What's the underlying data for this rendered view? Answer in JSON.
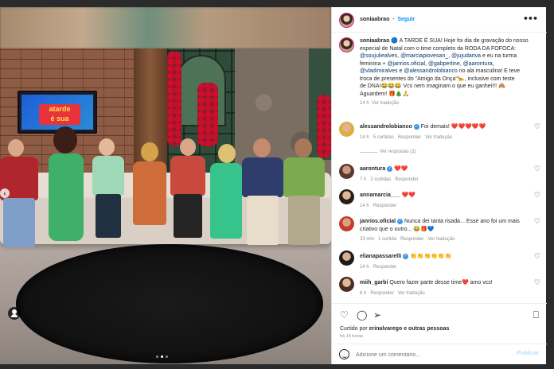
{
  "post_header": {
    "username": "soniaabrao",
    "separator": "•",
    "follow_label": "Seguir"
  },
  "caption": {
    "username": "soniaabrao",
    "lines": [
      "A TARDE É SUA! Hoje foi dia de gravação do nosso",
      "especial de Natal com o time completo da RODA DA FOFOCA:",
      "e eu na turma",
      "feminina +",
      "no ala masculina! E teve",
      "troca de presentes do \"Amigo da Onça\"🐆, inclusive com teste",
      "de DNA!😂😂😂 Vcs nem imaginam o que eu ganhei!!! 🙈",
      "Aguardem! 🎁🎄🙏"
    ],
    "intro_prefix": "🔵",
    "mentions_line3": [
      "@soujuliealves",
      "@marciapiovesan_",
      "@jujudariva"
    ],
    "mentions_line4": [
      "@janrios.oficial",
      "@gabperline",
      "@aarontura"
    ],
    "mentions_line5": [
      "@vladimiralves",
      "@alessandrolobianco"
    ],
    "time": "14 h",
    "translate": "Ver tradução"
  },
  "comments": [
    {
      "username": "alessandrolobianco",
      "verified": true,
      "text": "Foi demais! ❤️❤️❤️❤️❤️",
      "time": "14 h",
      "likes": "5 curtidas",
      "reply": "Responder",
      "translate": "Ver tradução",
      "view_replies": "Ver respostas (1)"
    },
    {
      "username": "aarontura",
      "verified": true,
      "text": "❤️❤️",
      "time": "7 h",
      "likes": "2 curtidas",
      "reply": "Responder"
    },
    {
      "username": "annamarcia___",
      "verified": false,
      "text": "❤️❤️",
      "time": "14 h",
      "reply": "Responder"
    },
    {
      "username": "janrios.oficial",
      "verified": true,
      "text": "Nunca dei tanta risada... Esse ano foi um mais",
      "text2": "criativo que o outro... 😂🎁💙",
      "time": "33 min",
      "likes": "1 curtida",
      "reply": "Responder",
      "translate": "Ver tradução"
    },
    {
      "username": "elianapassarelli",
      "verified": true,
      "text": "👏👏👏👏👏👏",
      "time": "14 h",
      "reply": "Responder"
    },
    {
      "username": "miih_garbi",
      "verified": false,
      "text": "Quero fazer parte desse time❤️ amo vcs!",
      "time": "6 h",
      "reply": "Responder",
      "translate": "Ver tradução"
    }
  ],
  "actions": {
    "liked_by_prefix": "Curtido por",
    "liked_by_user": "erinalvarego",
    "liked_by_suffix": "e outras pessoas",
    "post_time": "há 14 horas"
  },
  "comment_box": {
    "placeholder": "Adicione um comentário...",
    "post_label": "Publicar"
  },
  "tv_logo": {
    "line1": "atarde",
    "line2": "é sua"
  },
  "icons": {
    "like": "heart-icon",
    "comment": "comment-icon",
    "share": "share-icon",
    "save": "bookmark-icon",
    "more": "more-options-icon",
    "emoji": "emoji-icon",
    "tag": "user-tag-icon",
    "prev": "chevron-left-icon"
  },
  "colors": {
    "accent": "#0095f6",
    "link": "#00376b",
    "verified": "#3897f0",
    "muted": "#8e8e8e"
  }
}
